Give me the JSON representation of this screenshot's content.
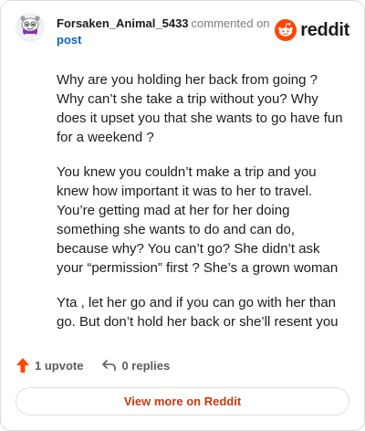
{
  "comment": {
    "username": "Forsaken_Animal_5433",
    "action_text": "commented on",
    "post_link_text": "post",
    "paragraphs": [
      "Why are you holding her back from going ? Why can’t she take a trip without you? Why does it upset you that she wants to go have fun for a weekend ?",
      "You knew you couldn’t make a trip and you knew how important it was to her to travel. You’re getting mad at her for her doing something she wants to do and can do, because why? You can’t go? She didn’t ask your “permission” first ? She’s a grown woman",
      "Yta , let her go and if you can go with her than go. But don’t hold her back or she’ll resent you"
    ]
  },
  "brand": {
    "wordmark": "reddit",
    "icon": "reddit-snoo-icon",
    "color": "#ff4500"
  },
  "stats": {
    "upvotes_label": "1 upvote",
    "upvote_icon": "upvote-arrow-icon",
    "upvote_color": "#ff4500",
    "replies_label": "0 replies",
    "reply_icon": "reply-arrow-icon"
  },
  "footer": {
    "view_more_label": "View more on Reddit",
    "view_more_color": "#c8370f"
  },
  "avatar": {
    "icon": "snoo-avatar-icon",
    "accent": "#8c2fb8"
  }
}
